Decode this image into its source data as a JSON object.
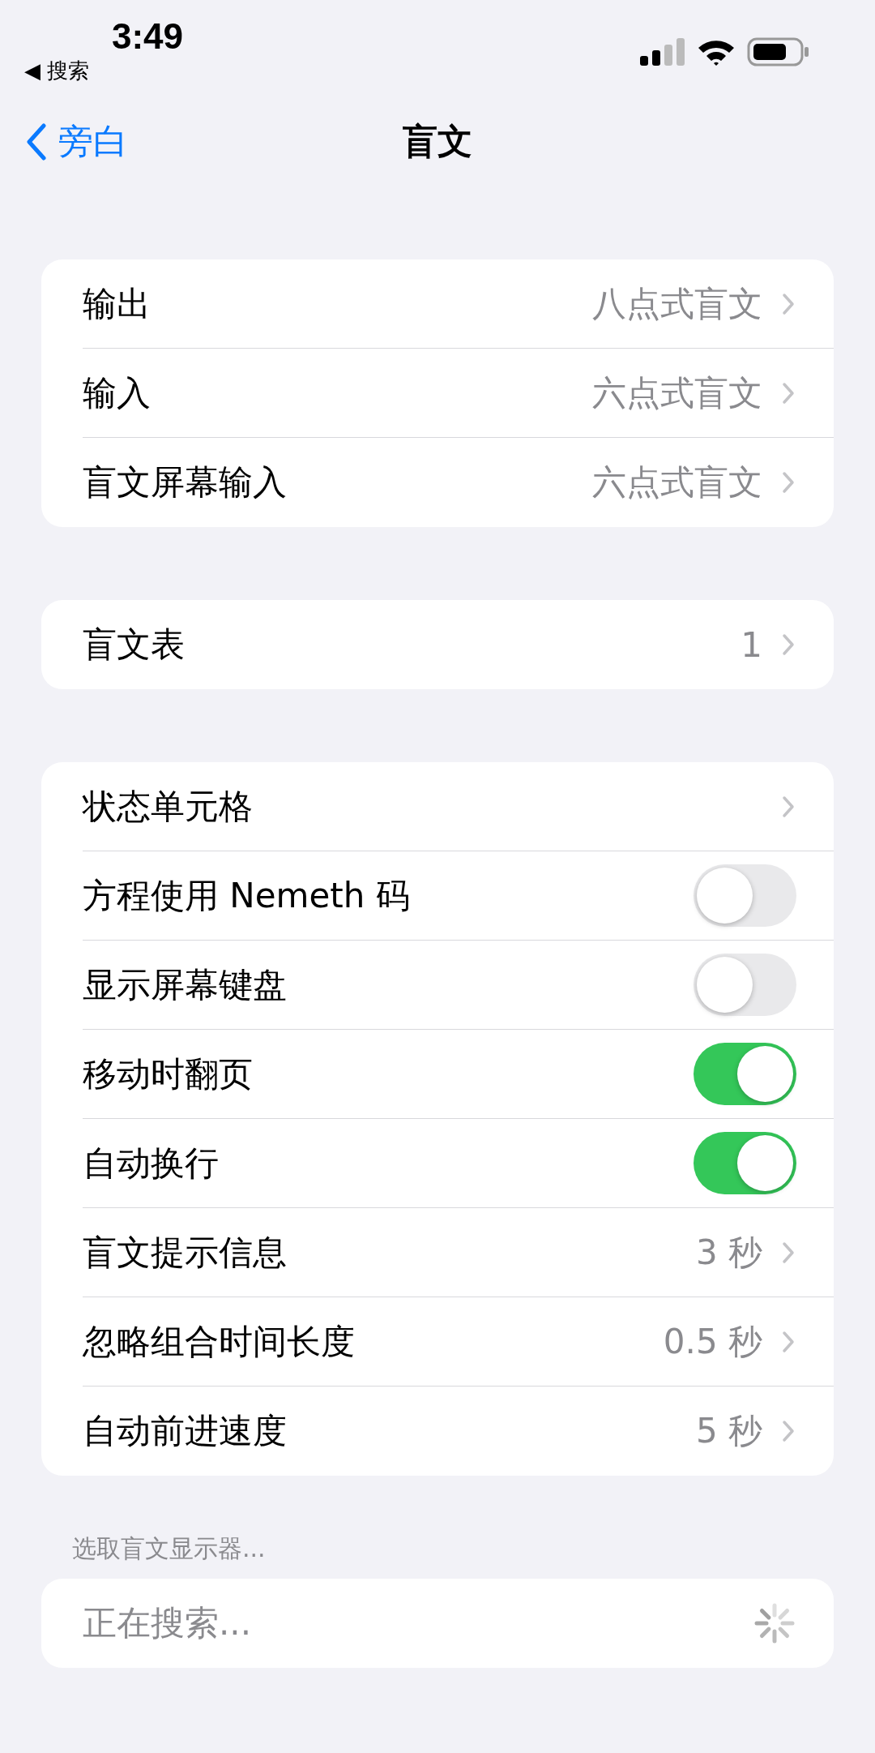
{
  "status_bar": {
    "time": "3:49",
    "back_app": "◀ 搜索"
  },
  "nav": {
    "back": "旁白",
    "title": "盲文"
  },
  "groups": [
    {
      "rows": [
        {
          "kind": "link",
          "label": "输出",
          "value": "八点式盲文"
        },
        {
          "kind": "link",
          "label": "输入",
          "value": "六点式盲文"
        },
        {
          "kind": "link",
          "label": "盲文屏幕输入",
          "value": "六点式盲文"
        }
      ]
    },
    {
      "rows": [
        {
          "kind": "link",
          "label": "盲文表",
          "value": "1"
        }
      ]
    },
    {
      "rows": [
        {
          "kind": "link",
          "label": "状态单元格"
        },
        {
          "kind": "toggle",
          "label": "方程使用 Nemeth 码",
          "on": false
        },
        {
          "kind": "toggle",
          "label": "显示屏幕键盘",
          "on": false
        },
        {
          "kind": "toggle",
          "label": "移动时翻页",
          "on": true
        },
        {
          "kind": "toggle",
          "label": "自动换行",
          "on": true
        },
        {
          "kind": "link",
          "label": "盲文提示信息",
          "value": "3 秒"
        },
        {
          "kind": "link",
          "label": "忽略组合时间长度",
          "value": "0.5 秒"
        },
        {
          "kind": "link",
          "label": "自动前进速度",
          "value": "5 秒"
        }
      ]
    },
    {
      "header": "选取盲文显示器...",
      "rows": [
        {
          "kind": "loading",
          "label": "正在搜索..."
        }
      ]
    }
  ]
}
